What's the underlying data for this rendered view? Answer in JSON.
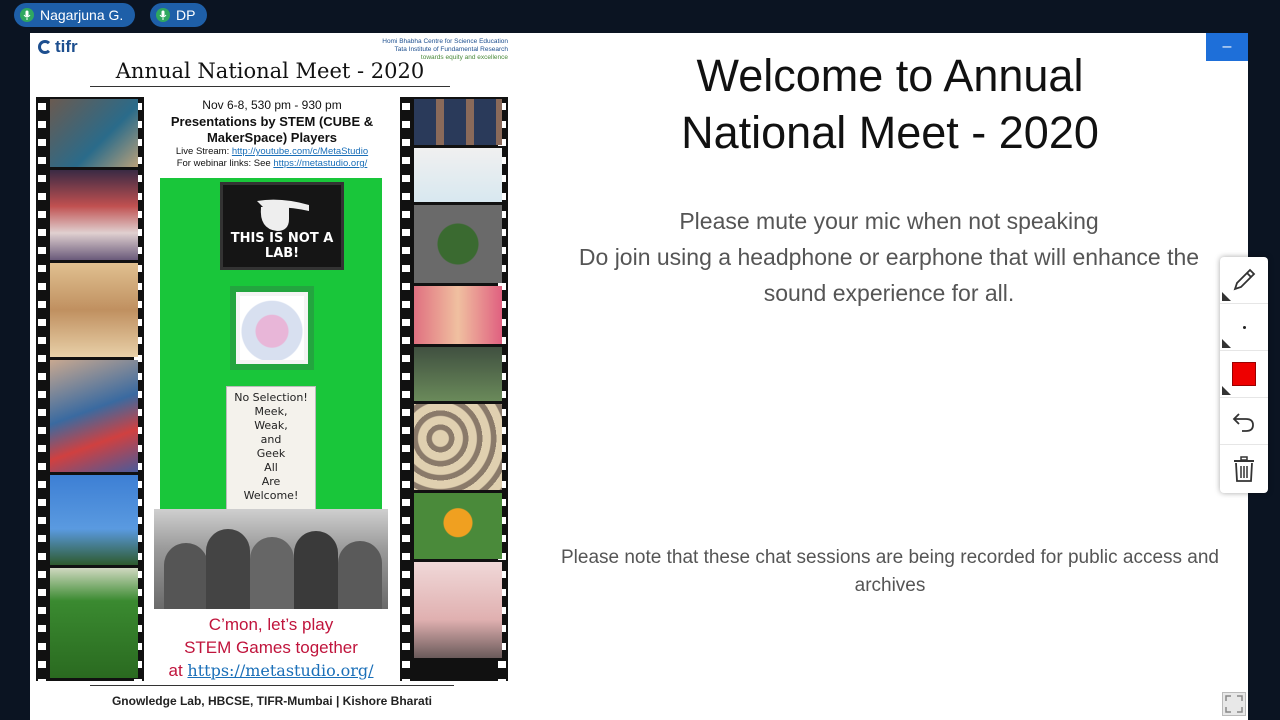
{
  "participants": [
    {
      "name": "Nagarjuna G."
    },
    {
      "name": "DP"
    }
  ],
  "controls": {
    "minimize_glyph": "–"
  },
  "poster": {
    "logo_text": "tifr",
    "institution_line1": "Homi Bhabha Centre for Science Education",
    "institution_line2": "Tata Institute of Fundamental Research",
    "institution_line3": "towards equity and excellence",
    "title": "Annual National Meet - 2020",
    "dates": "Nov 6-8,  530 pm - 930 pm",
    "presentations": "Presentations by STEM (CUBE & MakerSpace) Players",
    "live_stream_label": "Live Stream:",
    "live_stream_url": "http://youtube.com/c/MetaStudio",
    "webinar_label": "For webinar links: See",
    "webinar_url": "https://metastudio.org/",
    "sign_text": "THIS IS NOT A LAB!",
    "note_lines": [
      "No Selection!",
      "Meek,",
      "Weak,",
      "and",
      "Geek",
      "All",
      "Are",
      "Welcome!"
    ],
    "cmon_line1": "C’mon, let’s play",
    "cmon_line2": "STEM Games together",
    "cmon_at": "at",
    "cmon_url": "https://metastudio.org/",
    "footer": "Gnowledge Lab, HBCSE, TIFR-Mumbai | Kishore Bharati"
  },
  "slide": {
    "welcome_line1": "Welcome to Annual",
    "welcome_line2": "National Meet - 2020",
    "instruction_line1": "Please mute your mic when not speaking",
    "instruction_line2": "Do join using a headphone or earphone that will enhance the",
    "instruction_line3": "sound experience for all.",
    "record_note_line1": "Please note that these chat sessions are being recorded for public access and",
    "record_note_line2": "archives"
  },
  "toolbar": {
    "tools": [
      "pencil-tool",
      "pen-size-tool",
      "color-tool",
      "undo-tool",
      "delete-tool"
    ],
    "selected_color": "#ee0000"
  },
  "colors": {
    "background": "#0b1422",
    "chip": "#1e5fa8",
    "accent": "#1e6fd9",
    "poster_green": "#19c63a",
    "poster_red_text": "#c0143c"
  }
}
